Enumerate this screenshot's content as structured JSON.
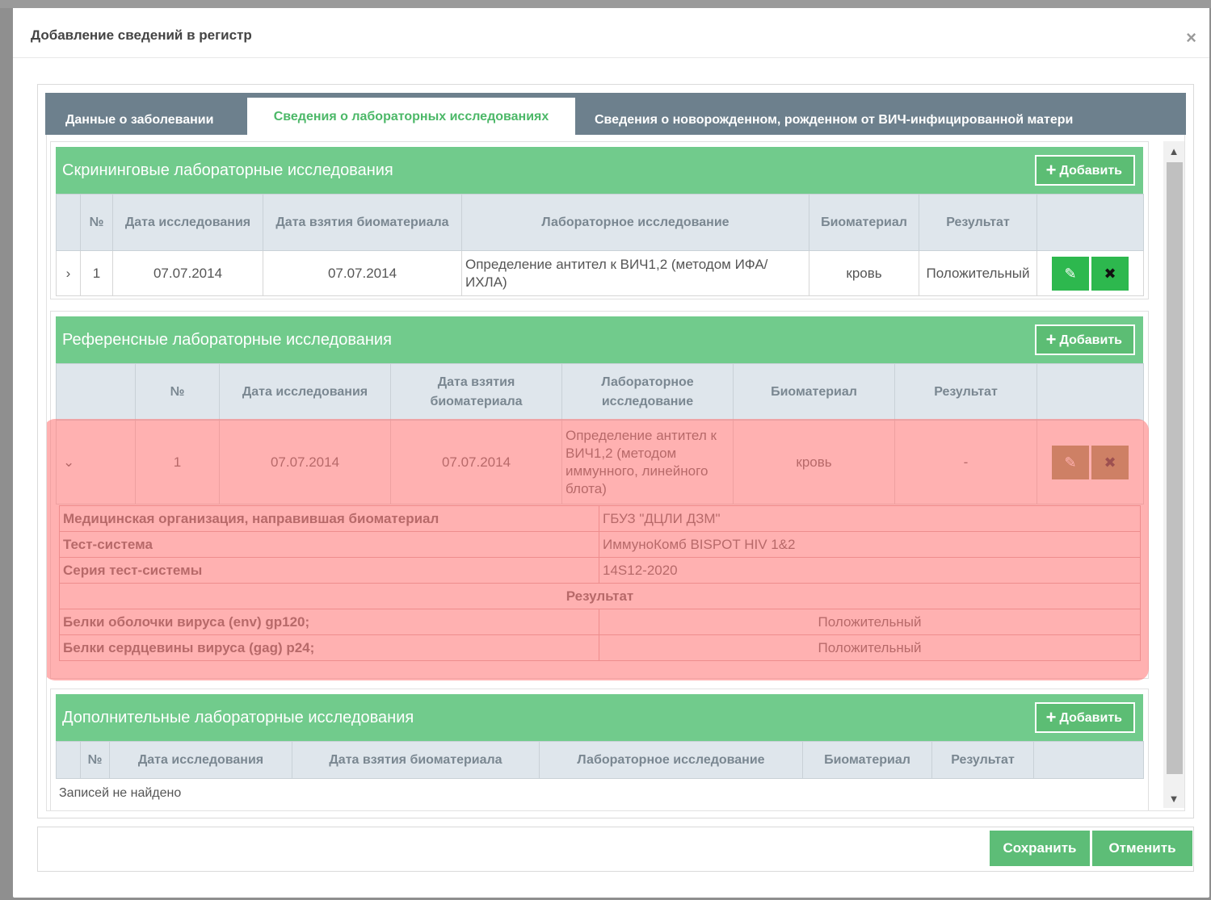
{
  "modal": {
    "title": "Добавление сведений в регистр",
    "close": "×"
  },
  "tabs": [
    {
      "label": "Данные о заболевании",
      "active": false
    },
    {
      "label": "Сведения о лабораторных исследованиях",
      "active": true
    },
    {
      "label": "Сведения о новорожденном, рожденном от ВИЧ-инфицированной матери",
      "active": false
    }
  ],
  "add_label": "Добавить",
  "screening": {
    "title": "Скрининговые лабораторные исследования",
    "headers": [
      "№",
      "Дата исследования",
      "Дата взятия биоматериала",
      "Лабораторное исследование",
      "Биоматериал",
      "Результат"
    ],
    "rows": [
      {
        "expand": "›",
        "num": "1",
        "date": "07.07.2014",
        "bio_date": "07.07.2014",
        "test": "Определение антител к ВИЧ1,2 (методом ИФА/ИХЛА)",
        "biomaterial": "кровь",
        "result": "Положительный"
      }
    ]
  },
  "reference": {
    "title": "Референсные лабораторные исследования",
    "headers": [
      "№",
      "Дата исследования",
      "Дата взятия биоматериала",
      "Лабораторное исследование",
      "Биоматериал",
      "Результат"
    ],
    "rows": [
      {
        "expand": "⌄",
        "num": "1",
        "date": "07.07.2014",
        "bio_date": "07.07.2014",
        "test": "Определение антител к ВИЧ1,2 (методом иммунного, линейного блота)",
        "biomaterial": "кровь",
        "result": "-"
      }
    ],
    "details": {
      "org_label": "Медицинская организация, направившая биоматериал",
      "org_value": "ГБУЗ \"ДЦЛИ ДЗМ\"",
      "system_label": "Тест-система",
      "system_value": "ИммуноКомб BISPOT HIV 1&2",
      "series_label": "Серия тест-системы",
      "series_value": "14S12-2020",
      "result_header": "Результат",
      "results": [
        {
          "label": "Белки оболочки вируса (env) gp120;",
          "value": "Положительный"
        },
        {
          "label": "Белки сердцевины вируса (gag) p24;",
          "value": "Положительный"
        }
      ]
    }
  },
  "additional": {
    "title": "Дополнительные лабораторные исследования",
    "headers": [
      "№",
      "Дата исследования",
      "Дата взятия биоматериала",
      "Лабораторное исследование",
      "Биоматериал",
      "Результат"
    ],
    "empty": "Записей не найдено"
  },
  "footer": {
    "save": "Сохранить",
    "cancel": "Отменить"
  },
  "colors": {
    "accent": "#71cb8c",
    "tabbar": "#6d808d",
    "highlight": "#ff7878"
  }
}
